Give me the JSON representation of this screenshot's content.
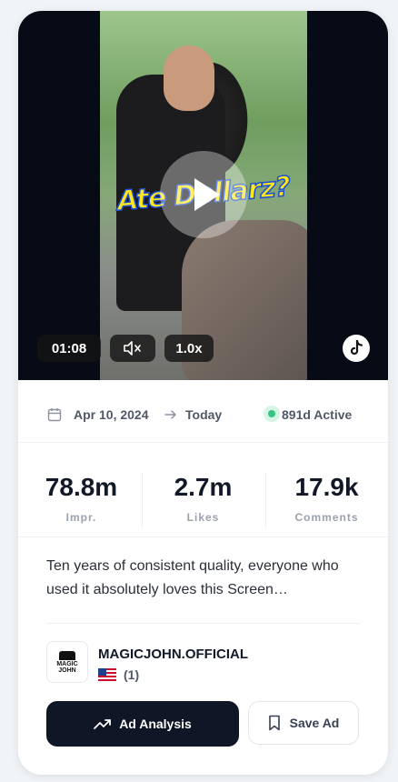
{
  "video": {
    "overlay_text": "Ate Dollarz?",
    "duration": "01:08",
    "mute_icon": "speaker-mute-icon",
    "speed": "1.0x",
    "platform_icon": "tiktok-icon"
  },
  "dates": {
    "start": "Apr 10, 2024",
    "end": "Today",
    "active": "891d Active",
    "active_color": "#33c581"
  },
  "stats": [
    {
      "value": "78.8m",
      "label": "Impr."
    },
    {
      "value": "2.7m",
      "label": "Likes"
    },
    {
      "value": "17.9k",
      "label": "Comments"
    }
  ],
  "description": "Ten years of consistent quality, everyone who used it absolutely loves this Screen…",
  "advertiser": {
    "logo_text_1": "MAGIC",
    "logo_text_2": "JOHN",
    "name": "MAGICJOHN.OFFICIAL",
    "country_flag": "us-flag-icon",
    "count": "(1)"
  },
  "actions": {
    "analysis_label": "Ad Analysis",
    "save_label": "Save Ad"
  },
  "colors": {
    "primary_button": "#0f1626",
    "text_dark": "#111827",
    "text_muted": "#9aa1ad"
  }
}
